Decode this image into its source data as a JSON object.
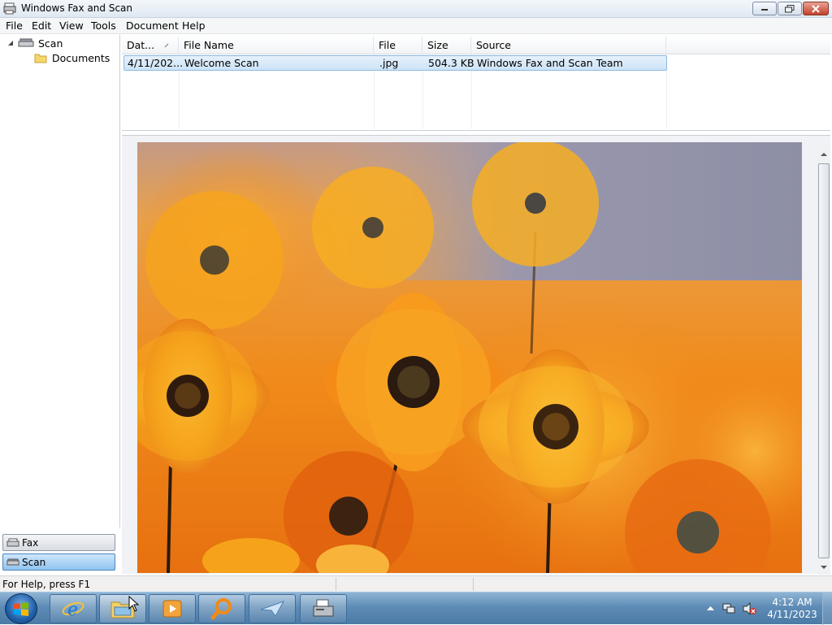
{
  "window": {
    "title": "Windows Fax and Scan"
  },
  "menu": [
    "File",
    "Edit",
    "View",
    "Tools",
    "Document",
    "Help"
  ],
  "tree": {
    "root": "Scan",
    "child": "Documents"
  },
  "nav": {
    "fax_label": "Fax",
    "scan_label": "Scan"
  },
  "list": {
    "columns": [
      "Dat...",
      "File Name",
      "File Type",
      "Size",
      "Source"
    ],
    "rows": [
      {
        "date": "4/11/202...",
        "name": "Welcome Scan",
        "type": ".jpg",
        "size": "504.3 KB",
        "source": "Windows Fax and Scan Team"
      }
    ]
  },
  "status": {
    "help": "For Help, press F1"
  },
  "taskbar": {
    "time": "4:12 AM",
    "date": "4/11/2023"
  },
  "colors": {
    "accent": "#8fc3ee",
    "titlebar": "#dfe8f2",
    "close_button": "#c4402b",
    "taskbar": "#5e8cb6"
  }
}
